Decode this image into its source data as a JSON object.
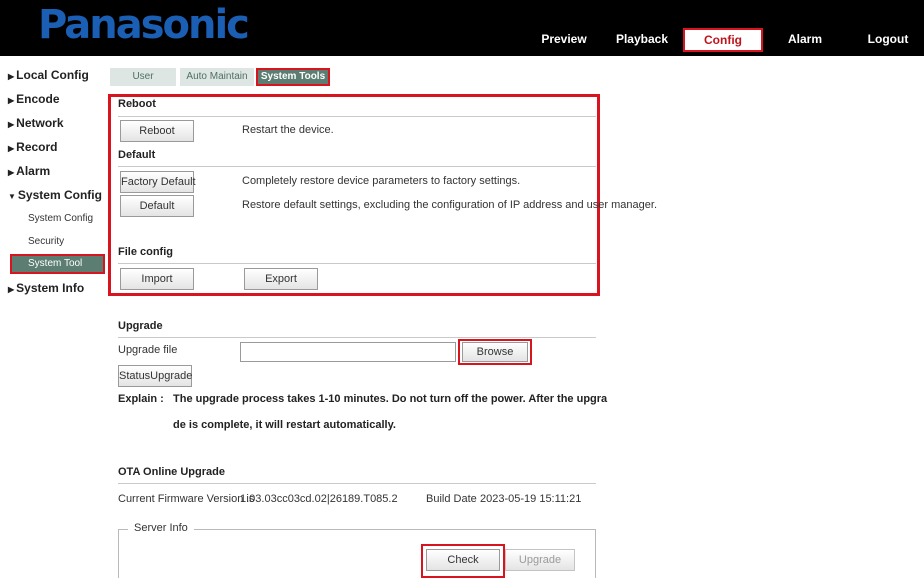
{
  "header": {
    "logo": "Panasonic",
    "nav": [
      {
        "label": "Preview"
      },
      {
        "label": "Playback"
      },
      {
        "label": "Config"
      },
      {
        "label": "Alarm"
      },
      {
        "label": "Logout"
      }
    ]
  },
  "sidebar": {
    "items": [
      {
        "label": "Local Config"
      },
      {
        "label": "Encode"
      },
      {
        "label": "Network"
      },
      {
        "label": "Record"
      },
      {
        "label": "Alarm"
      },
      {
        "label": "System Config"
      },
      {
        "label": "System Info"
      }
    ],
    "sub_items": [
      {
        "label": "System Config"
      },
      {
        "label": "Security"
      },
      {
        "label": "System Tool"
      }
    ]
  },
  "tabs": [
    {
      "label": "User"
    },
    {
      "label": "Auto Maintain"
    },
    {
      "label": "System Tools"
    }
  ],
  "reboot": {
    "title": "Reboot",
    "button": "Reboot",
    "desc": "Restart the device."
  },
  "default": {
    "title": "Default",
    "factory_button": "Factory Default",
    "factory_desc": "Completely restore device parameters to factory settings.",
    "default_button": "Default",
    "default_desc": "Restore default settings, excluding the configuration of IP address and user manager."
  },
  "file_config": {
    "title": "File config",
    "import_button": "Import",
    "export_button": "Export"
  },
  "upgrade": {
    "title": "Upgrade",
    "file_label": "Upgrade file",
    "file_value": "",
    "browse_button": "Browse",
    "status_button": "StatusUpgrade",
    "explain_label": "Explain :",
    "explain_line1": "The upgrade process takes 1-10 minutes. Do not turn off the power. After the upgra",
    "explain_line2": "de is complete, it will restart automatically."
  },
  "ota": {
    "title": "OTA Online Upgrade",
    "firmware_label": "Current Firmware Version is",
    "firmware_value": "1.03.03cc03cd.02|26189.T085.2",
    "build_label": "Build Date",
    "build_value": "2023-05-19 15:11:21",
    "server_info_legend": "Server Info",
    "check_button": "Check",
    "upgrade_button": "Upgrade"
  }
}
